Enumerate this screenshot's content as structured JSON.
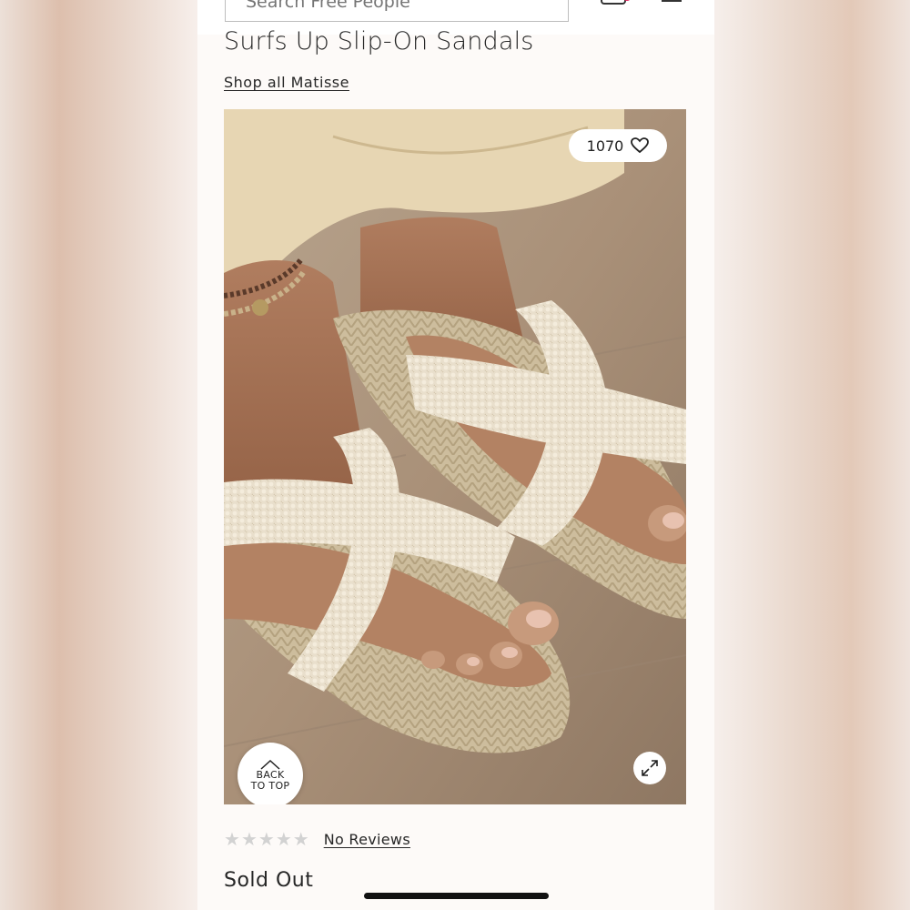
{
  "header": {
    "search_placeholder": "Search Free People",
    "bag_badge_color": "#e0245e"
  },
  "product": {
    "title": "Surfs Up Slip-On Sandals",
    "brand_link": "Shop all Matisse",
    "likes": "1070",
    "back_to_top_line1": "BACK",
    "back_to_top_line2": "TO TOP",
    "rating_stars": 0,
    "reviews_link": "No Reviews",
    "status": "Sold Out"
  },
  "colors": {
    "text": "#262626",
    "star_empty": "#d2d2d2",
    "background": "#fdfaf8"
  },
  "icons": {
    "search": "search-icon",
    "bag": "bag-icon",
    "menu": "menu-icon",
    "heart": "heart-icon",
    "expand": "expand-icon",
    "chevron_up": "chevron-up-icon",
    "star": "star-icon"
  }
}
